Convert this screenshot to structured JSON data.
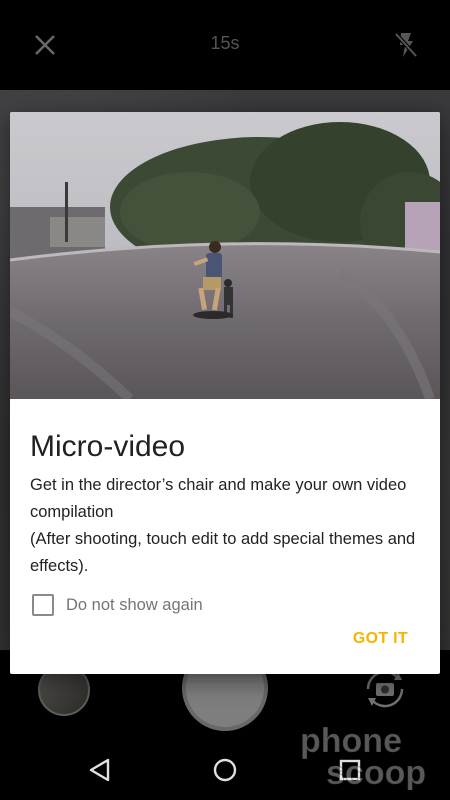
{
  "top_bar": {
    "timer": "15s",
    "close_icon": "close-icon",
    "flash_icon": "flash-off-icon"
  },
  "dialog": {
    "title": "Micro-video",
    "body_line1": "Get in the director’s chair and make your own video compilation",
    "body_line2": "(After shooting, touch edit to add special themes and effects).",
    "checkbox_label": "Do not show again",
    "checkbox_checked": false,
    "confirm_label": "GOT IT",
    "confirm_color": "#f4b400"
  },
  "camera_controls": {
    "gallery_icon": "gallery-thumbnail",
    "shutter_icon": "shutter-icon",
    "switch_icon": "switch-camera-icon"
  },
  "nav_bar": {
    "back_icon": "back-icon",
    "home_icon": "home-icon",
    "recent_icon": "recent-apps-icon"
  },
  "watermark": {
    "line1": "phone",
    "line2": "scoop"
  }
}
